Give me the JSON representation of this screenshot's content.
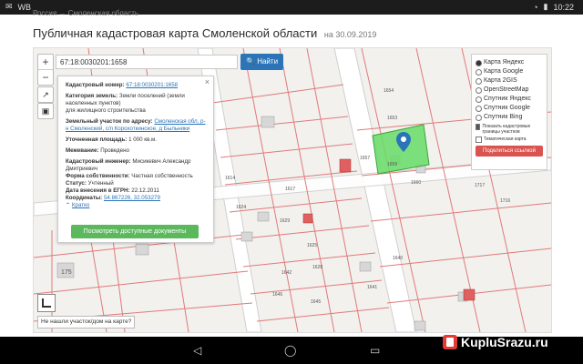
{
  "statusbar": {
    "carrier": "WB",
    "time": "10:22",
    "battery": "100%"
  },
  "breadcrumb": {
    "text": "Россия → Смоленская область"
  },
  "page": {
    "title": "Публичная кадастровая карта Смоленской области",
    "date": "на 30.09.2019"
  },
  "search": {
    "value": "67:18:0030201:1658",
    "button": "Найти"
  },
  "card": {
    "cadastral_label": "Кадастровый номер:",
    "cadastral_value": "67:18:0030201:1658",
    "category_label": "Категория земель:",
    "category_value": "Земли поселений (земли населенных пунктов)",
    "purpose": "для жилищного строительства",
    "address_label": "Земельный участок по адресу:",
    "address_value": "Смоленская обл, р-н Смоленский, с/п Корохоткинское, д Быльники",
    "area_label": "Уточненная площадь:",
    "area_value": "1 000 кв.м.",
    "survey_label": "Межевание:",
    "survey_value": "Проведено",
    "engineer_label": "Кадастровый инженер:",
    "engineer_value": "Мисикевич Александр Дмитриевич",
    "ownership_label": "Форма собственности:",
    "ownership_value": "Частная собственность",
    "status_label": "Статус:",
    "status_value": "Учтенный",
    "egrn_label": "Дата внесения в ЕГРН:",
    "egrn_value": "22.12.2011",
    "coords_label": "Координаты:",
    "coords_value": "54.867226, 32.053279",
    "brief": "Кратко",
    "docs_button": "Посмотреть доступные документы"
  },
  "layers": {
    "options": [
      {
        "label": "Карта Яндекс",
        "selected": true
      },
      {
        "label": "Карта Google",
        "selected": false
      },
      {
        "label": "Карта 2GIS",
        "selected": false
      },
      {
        "label": "OpenStreetMap",
        "selected": false
      },
      {
        "label": "Спутник Яндекс",
        "selected": false
      },
      {
        "label": "Спутник Google",
        "selected": false
      },
      {
        "label": "Спутник Bing",
        "selected": false
      }
    ],
    "show_boundaries": "Показать кадастровые границы участков",
    "thematic_map": "Тематическая карта",
    "share_button": "Поделиться ссылкой"
  },
  "map": {
    "not_found": "Не нашли участок/дом на карте?"
  },
  "parcel_labels": [
    "1654",
    "1653",
    "1657",
    "1659",
    "1660",
    "1617",
    "1614",
    "1624",
    "1625",
    "1628",
    "1629",
    "1641",
    "1642",
    "1646",
    "1645",
    "1640",
    "175",
    "1717",
    "1716"
  ],
  "colors": {
    "accent": "#2b74b8",
    "selected_parcel": "#66dd66",
    "share": "#d9534f",
    "docs": "#5cb85c"
  },
  "watermark": {
    "text": "KupluSrazu.ru"
  }
}
